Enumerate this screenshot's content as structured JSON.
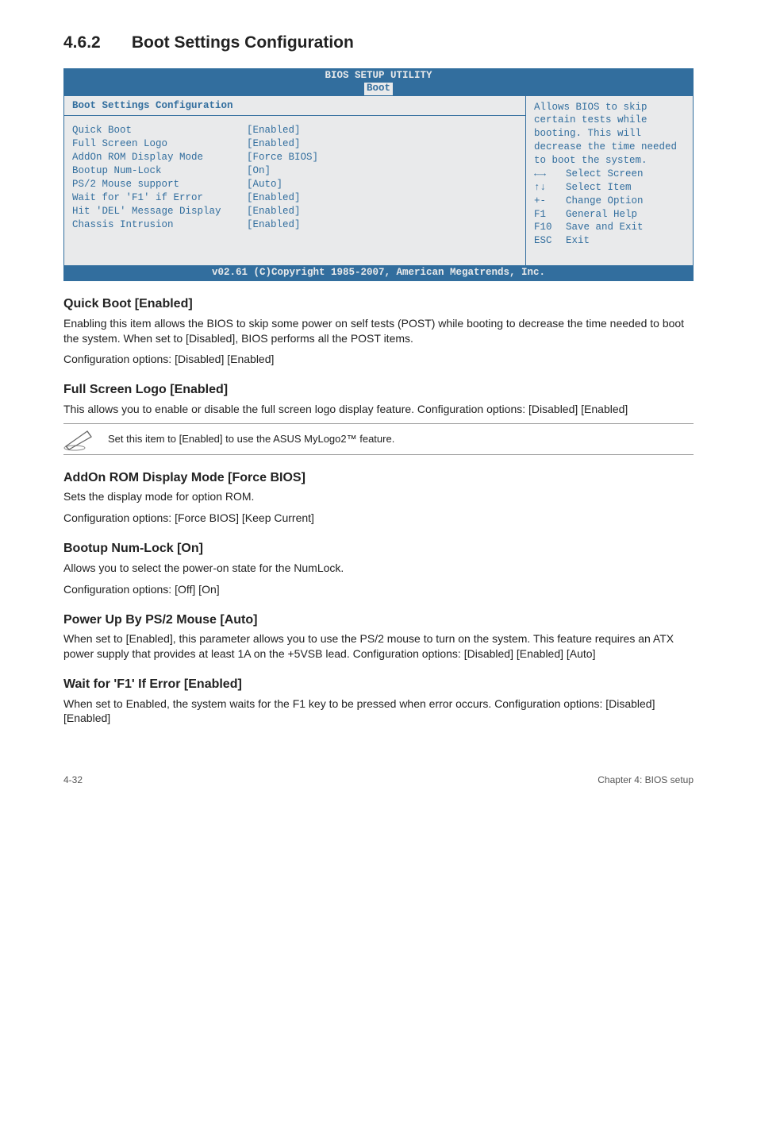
{
  "section": {
    "number": "4.6.2",
    "title": "Boot Settings Configuration"
  },
  "bios": {
    "title": "BIOS SETUP UTILITY",
    "menu": "Boot",
    "panelTitle": "Boot Settings Configuration",
    "settings": [
      {
        "label": "Quick Boot",
        "value": "[Enabled]"
      },
      {
        "label": "Full Screen Logo",
        "value": "[Enabled]"
      },
      {
        "label": "AddOn ROM Display Mode",
        "value": "[Force BIOS]"
      },
      {
        "label": "Bootup Num-Lock",
        "value": "[On]"
      },
      {
        "label": "PS/2 Mouse support",
        "value": "[Auto]"
      },
      {
        "label": "Wait for 'F1' if Error",
        "value": "[Enabled]"
      },
      {
        "label": "Hit 'DEL' Message Display",
        "value": "[Enabled]"
      },
      {
        "label": "Chassis Intrusion",
        "value": "[Enabled]"
      }
    ],
    "help": "Allows BIOS to skip certain tests while booting. This will decrease the time needed to boot the system.",
    "keys": [
      {
        "k": "←→",
        "d": "Select Screen"
      },
      {
        "k": "↑↓",
        "d": "Select Item"
      },
      {
        "k": "+-",
        "d": "Change Option"
      },
      {
        "k": "F1",
        "d": "General Help"
      },
      {
        "k": "F10",
        "d": "Save and Exit"
      },
      {
        "k": "ESC",
        "d": "Exit"
      }
    ],
    "footer": "v02.61 (C)Copyright 1985-2007, American Megatrends, Inc."
  },
  "quickBoot": {
    "heading": "Quick Boot [Enabled]",
    "p1": "Enabling this item allows the BIOS to skip some power on self tests (POST) while booting to decrease the time needed to boot the system. When set to [Disabled], BIOS performs all the POST items.",
    "p2": "Configuration options: [Disabled] [Enabled]"
  },
  "fullScreen": {
    "heading": "Full Screen Logo [Enabled]",
    "p1": "This allows you to enable or disable the full screen logo display feature. Configuration options: [Disabled] [Enabled]",
    "note": "Set this item to [Enabled] to use the ASUS MyLogo2™ feature."
  },
  "addOn": {
    "heading": "AddOn ROM Display Mode [Force BIOS]",
    "p1": "Sets the display mode for option ROM.",
    "p2": "Configuration options: [Force BIOS] [Keep Current]"
  },
  "numLock": {
    "heading": "Bootup Num-Lock [On]",
    "p1": "Allows you to select the power-on state for the NumLock.",
    "p2": "Configuration options: [Off] [On]"
  },
  "ps2": {
    "heading": "Power Up By PS/2 Mouse [Auto]",
    "p1": "When set to [Enabled], this parameter allows you to use the PS/2 mouse to turn on the system. This feature requires an ATX power supply that provides at least 1A on the +5VSB lead. Configuration options: [Disabled] [Enabled] [Auto]"
  },
  "waitF1": {
    "heading": "Wait for 'F1' If Error [Enabled]",
    "p1": "When set to Enabled, the system waits for the F1 key to be pressed when error occurs. Configuration options: [Disabled] [Enabled]"
  },
  "footer": {
    "left": "4-32",
    "right": "Chapter 4: BIOS setup"
  }
}
